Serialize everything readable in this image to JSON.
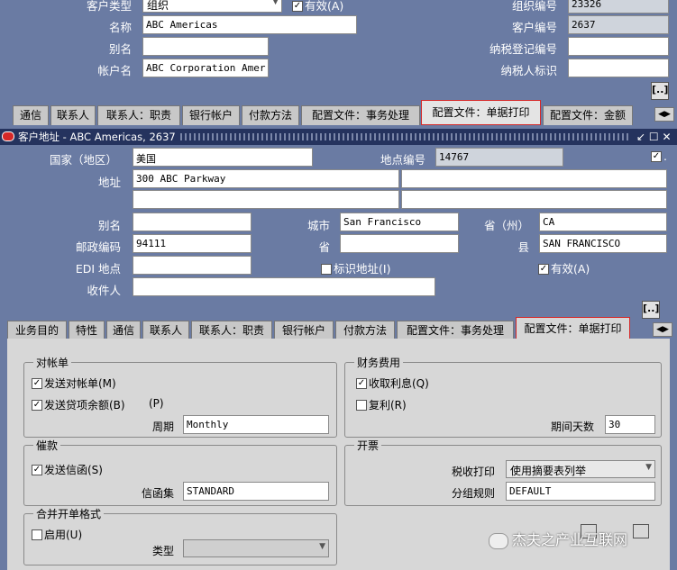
{
  "header": {
    "customer_type_label": "客户类型",
    "customer_type_value": "组织",
    "active_label": "有效(A)",
    "name_label": "名称",
    "name_value": "ABC Americas",
    "alias_label": "别名",
    "alias_value": "",
    "account_name_label": "帐户名",
    "account_name_value": "ABC Corporation Amer",
    "org_number_label": "组织编号",
    "org_number_value": "23326",
    "customer_number_label": "客户编号",
    "customer_number_value": "2637",
    "tax_reg_label": "纳税登记编号",
    "tax_reg_value": "",
    "taxpayer_id_label": "纳税人标识",
    "taxpayer_id_value": "",
    "more_button": "[..]"
  },
  "top_tabs": [
    {
      "label": "通信"
    },
    {
      "label": "联系人"
    },
    {
      "label": "联系人：职责"
    },
    {
      "label": "银行帐户"
    },
    {
      "label": "付款方法"
    },
    {
      "label": "配置文件：事务处理"
    },
    {
      "label": "配置文件：单据打印"
    },
    {
      "label": "配置文件：金额"
    }
  ],
  "address_window": {
    "title": "客户地址 - ABC Americas, 2637",
    "window_controls": "↙ ☐ ✕",
    "country_label": "国家（地区）",
    "country_value": "美国",
    "site_number_label": "地点编号",
    "site_number_value": "14767",
    "address_label": "地址",
    "address_line1": "300 ABC Parkway",
    "address_line2": "",
    "address_line3": "",
    "address_line4": "",
    "alias_label": "别名",
    "alias_value": "",
    "city_label": "城市",
    "city_value": "San Francisco",
    "state_label": "省（州）",
    "state_value": "CA",
    "postal_label": "邮政编码",
    "postal_value": "94111",
    "province_label": "省",
    "province_value": "",
    "county_label": "县",
    "county_value": "SAN FRANCISCO",
    "edi_label": "EDI 地点",
    "edi_value": "",
    "identifying_label": "标识地址(I)",
    "active_label": "有效(A)",
    "recipient_label": "收件人",
    "recipient_value": "",
    "more_button": "[..]"
  },
  "address_tabs": [
    {
      "label": "业务目的"
    },
    {
      "label": "特性"
    },
    {
      "label": "通信"
    },
    {
      "label": "联系人"
    },
    {
      "label": "联系人：职责"
    },
    {
      "label": "银行帐户"
    },
    {
      "label": "付款方法"
    },
    {
      "label": "配置文件：事务处理"
    },
    {
      "label": "配置文件：单据打印"
    }
  ],
  "statement": {
    "title": "对帐单",
    "send_statement": "发送对帐单(M)",
    "send_credit_balance": "发送贷项余额(B)",
    "p_label": "(P)",
    "cycle_label": "周期",
    "cycle_value": "Monthly"
  },
  "finance_charges": {
    "title": "财务费用",
    "charge_interest": "收取利息(Q)",
    "compound": "复利(R)",
    "days_label": "期间天数",
    "days_value": "30"
  },
  "dunning": {
    "title": "催款",
    "send_letters": "发送信函(S)",
    "letter_set_label": "信函集",
    "letter_set_value": "STANDARD"
  },
  "invoicing": {
    "title": "开票",
    "tax_printing_label": "税收打印",
    "tax_printing_value": "使用摘要表列举",
    "grouping_rule_label": "分组规则",
    "grouping_rule_value": "DEFAULT"
  },
  "consolidated": {
    "title": "合并开单格式",
    "enable": "启用(U)",
    "type_label": "类型",
    "type_value": ""
  },
  "watermark": {
    "text": "杰夫之产业互联网"
  }
}
